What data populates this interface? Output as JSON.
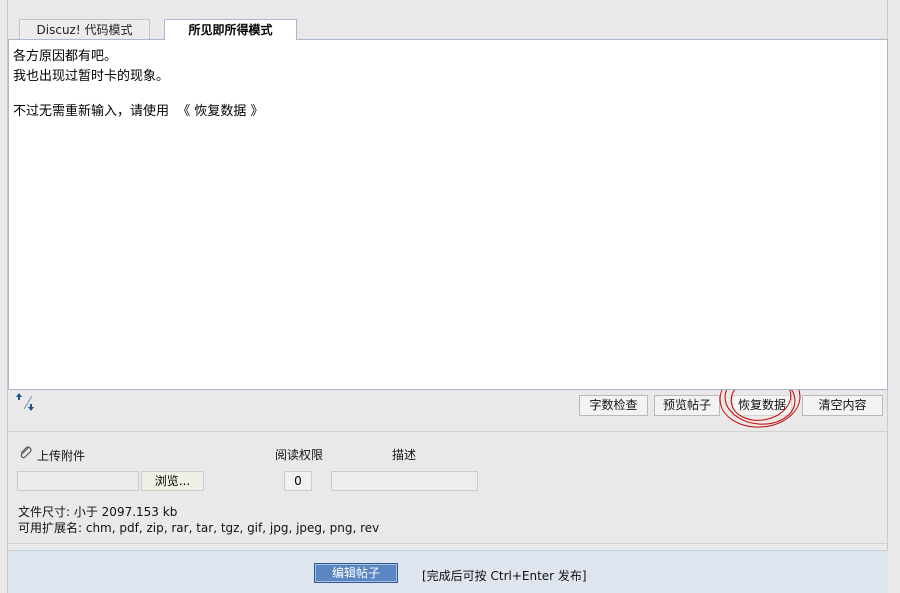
{
  "tabs": {
    "code_mode": "Discuz! 代码模式",
    "wysiwyg_mode": "所见即所得模式"
  },
  "editor": {
    "lines": [
      "各方原因都有吧。",
      "我也出现过暂时卡的现象。",
      "",
      "不过无需重新输入，请使用  《 恢复数据 》"
    ]
  },
  "toolbar": {
    "word_count": "字数检查",
    "preview": "预览帖子",
    "restore": "恢复数据",
    "clear": "清空内容"
  },
  "attachments": {
    "upload_label": "上传附件",
    "read_permission_label": "阅读权限",
    "description_label": "描述",
    "browse_button": "浏览...",
    "read_permission_value": "0",
    "file_size_info": "文件尺寸: 小于 2097.153 kb",
    "allowed_extensions": "可用扩展名: chm, pdf, zip, rar, tar, tgz, gif, jpg, jpeg, png, rev"
  },
  "submit": {
    "button_label": "编辑帖子",
    "hint": "[完成后可按 Ctrl+Enter 发布]"
  },
  "colors": {
    "annotation": "#cc0000",
    "submit_button": "#5a86c2",
    "editor_border": "#a9b8cf"
  },
  "icons": {
    "attach": "paperclip-icon",
    "resize": "resize-arrows-icon"
  }
}
